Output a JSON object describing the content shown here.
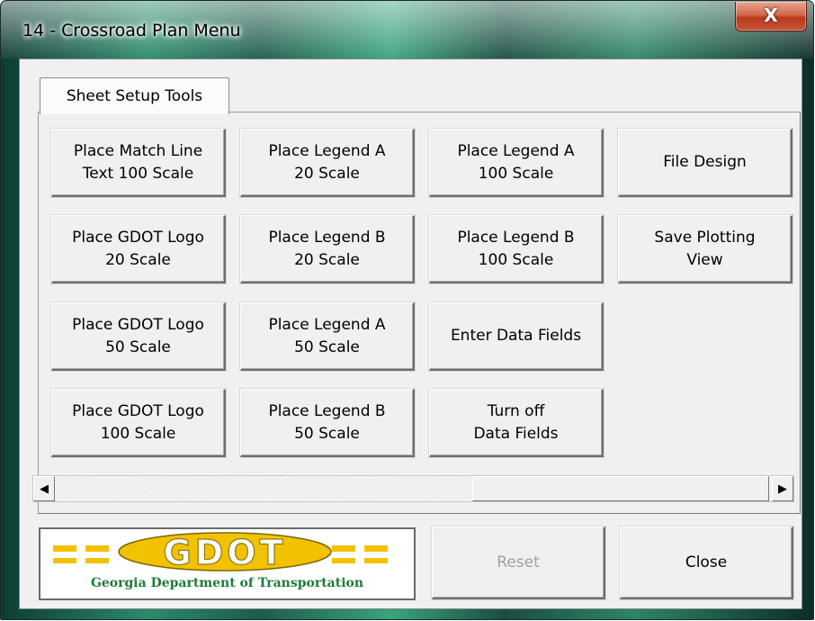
{
  "window": {
    "title": "14 - Crossroad Plan Menu",
    "close_glyph": "X"
  },
  "tabs": [
    {
      "label": "Sheet Setup Tools"
    }
  ],
  "buttons": {
    "match_line_100": "Place Match Line\nText 100 Scale",
    "legend_a_20": "Place Legend A\n20 Scale",
    "legend_a_100": "Place Legend A\n100 Scale",
    "file_design": "File Design",
    "gdot_logo_20": "Place GDOT Logo\n20 Scale",
    "legend_b_20": "Place Legend B\n20 Scale",
    "legend_b_100": "Place Legend B\n100 Scale",
    "save_plotting_view": "Save Plotting\nView",
    "gdot_logo_50": "Place GDOT Logo\n50 Scale",
    "legend_a_50": "Place Legend A\n50 Scale",
    "enter_data_fields": "Enter Data Fields",
    "gdot_logo_100": "Place GDOT Logo\n100 Scale",
    "legend_b_50": "Place Legend B\n50 Scale",
    "turn_off_data_fields": "Turn off\nData Fields"
  },
  "scrollbar": {
    "left_arrow": "◀",
    "right_arrow": "▶"
  },
  "logo": {
    "wordmark": "GDOT",
    "subtitle": "Georgia Department of Transportation",
    "primary_color": "#f2c200",
    "text_color": "#1f7a3a"
  },
  "footer": {
    "reset_label": "Reset",
    "close_label": "Close"
  }
}
